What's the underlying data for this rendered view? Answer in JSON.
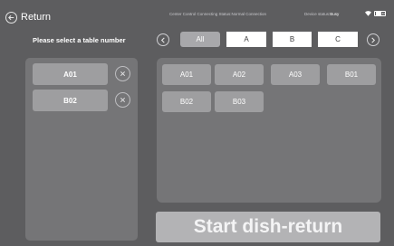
{
  "header": {
    "back_label": "Return",
    "connection_status": "Center Control Connecting Status:Normal Connection",
    "device_status_label": "Device status:",
    "device_status_value": "Busy",
    "battery_text": "40"
  },
  "prompt": "Please select a table number",
  "tabs": [
    {
      "label": "All",
      "active": true
    },
    {
      "label": "A",
      "active": false
    },
    {
      "label": "B",
      "active": false
    },
    {
      "label": "C",
      "active": false
    }
  ],
  "selected_tables": [
    "A01",
    "B02"
  ],
  "tables": [
    "A01",
    "A02",
    "A03",
    "B01",
    "B02",
    "B03"
  ],
  "start_button": "Start dish-return",
  "icons": {
    "back": "back-arrow-circle-icon",
    "prev": "chevron-left-icon",
    "next": "chevron-right-icon",
    "remove": "close-icon",
    "wifi": "wifi-icon",
    "battery": "battery-icon"
  }
}
